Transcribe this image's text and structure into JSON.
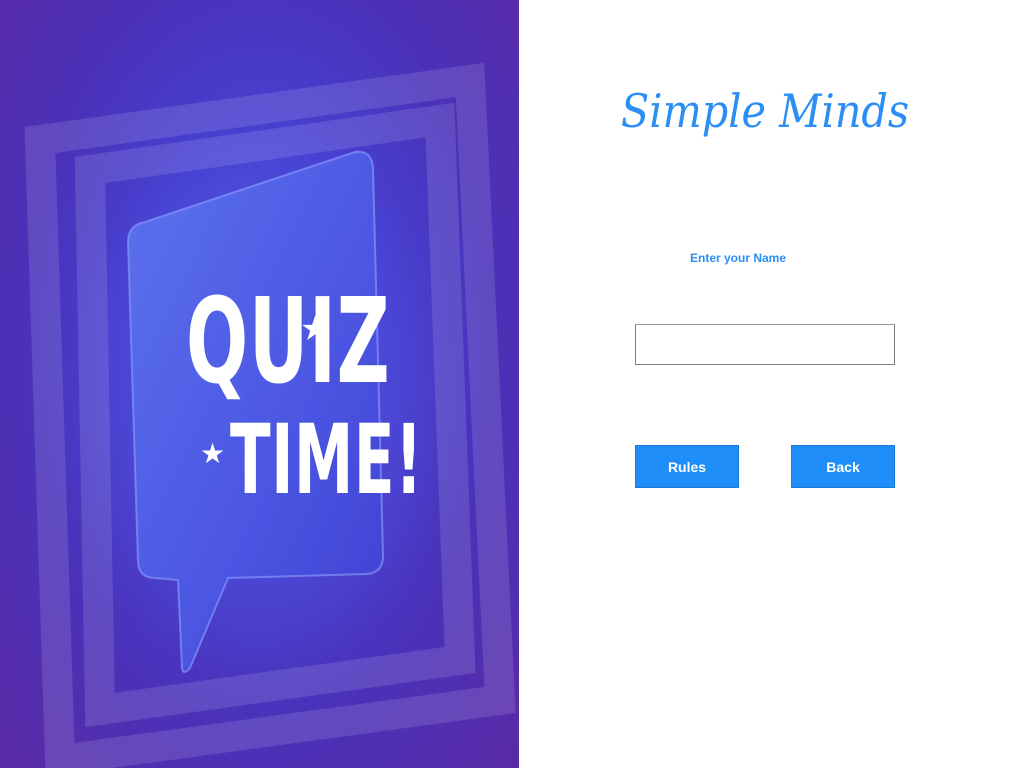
{
  "hero": {
    "line1": "QUIZ",
    "line2": "TIME!",
    "star_glyph": "★",
    "bubble_color": "#4f5ee6",
    "background_color": "#4b31b8"
  },
  "app": {
    "title": "Simple Minds",
    "title_color": "#2b8ef5"
  },
  "form": {
    "name_label": "Enter your Name",
    "name_value": "",
    "name_placeholder": ""
  },
  "buttons": {
    "rules_label": "Rules",
    "back_label": "Back",
    "color": "#1f8ef8"
  }
}
